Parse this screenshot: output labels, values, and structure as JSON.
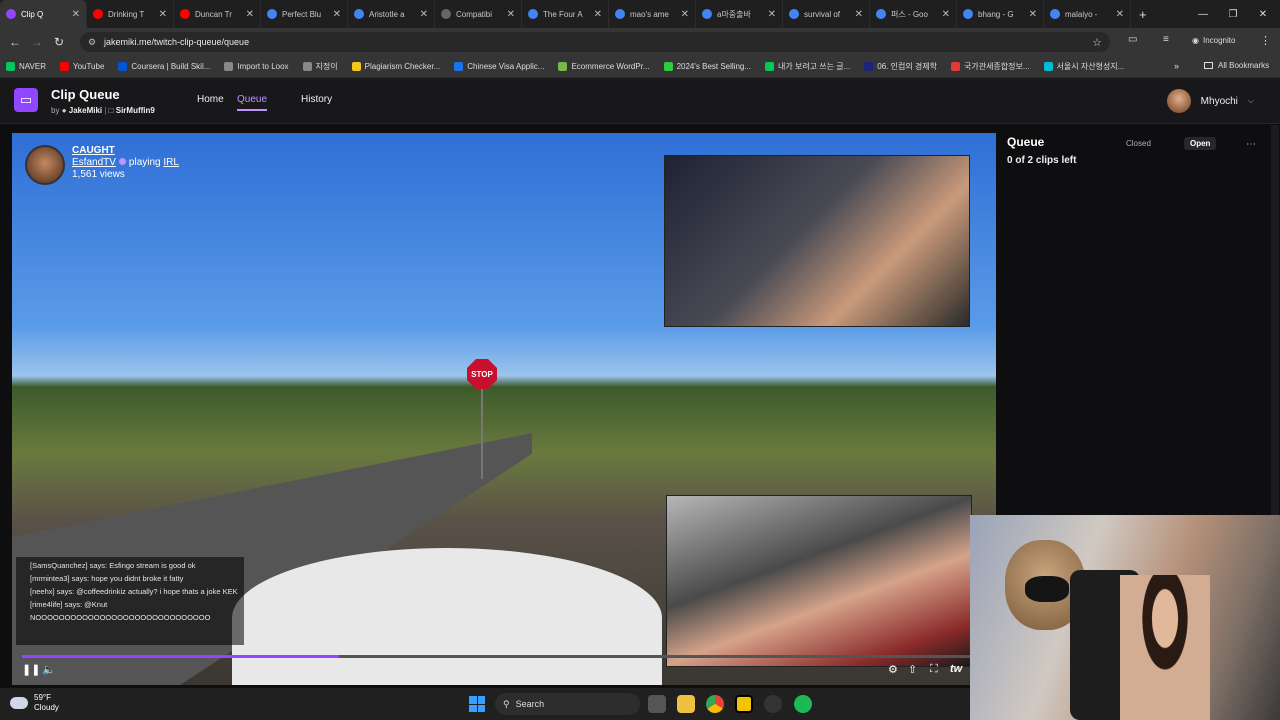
{
  "browser": {
    "tabs": [
      {
        "label": "Clip Q",
        "color": "#9147ff",
        "active": true
      },
      {
        "label": "Drinking T",
        "color": "#ff0000"
      },
      {
        "label": "Duncan Tr",
        "color": "#ff0000"
      },
      {
        "label": "Perfect Blu",
        "color": "#4285f4"
      },
      {
        "label": "Aristotle a",
        "color": "#4285f4"
      },
      {
        "label": "Compatibi",
        "color": "#666666"
      },
      {
        "label": "The Four A",
        "color": "#4285f4"
      },
      {
        "label": "mao's ame",
        "color": "#4285f4"
      },
      {
        "label": "a마중출바",
        "color": "#4285f4"
      },
      {
        "label": "survival of",
        "color": "#4285f4"
      },
      {
        "label": "퍼스 - Goo",
        "color": "#4285f4"
      },
      {
        "label": "bhang - G",
        "color": "#4285f4"
      },
      {
        "label": "malaiyo - ",
        "color": "#4285f4"
      }
    ],
    "url": "jakemiki.me/twitch-clip-queue/queue",
    "incognito_label": "Incognito",
    "all_bookmarks_label": "All Bookmarks",
    "bookmarks": [
      {
        "label": "NAVER",
        "color": "#03c75a"
      },
      {
        "label": "YouTube",
        "color": "#ff0000"
      },
      {
        "label": "Coursera | Build Skil...",
        "color": "#0056d2"
      },
      {
        "label": "Import to Loox",
        "color": "#888888"
      },
      {
        "label": "지정이",
        "color": "#888888"
      },
      {
        "label": "Plagiarism Checker...",
        "color": "#f5c518"
      },
      {
        "label": "Chinese Visa Applic...",
        "color": "#1a73e8"
      },
      {
        "label": "Ecommerce WordPr...",
        "color": "#7ab648"
      },
      {
        "label": "2024's Best Selling...",
        "color": "#2ecc40"
      },
      {
        "label": "내가 보려고 쓰는 글...",
        "color": "#03c75a"
      },
      {
        "label": "06. 인컴의 경제학",
        "color": "#1a237e"
      },
      {
        "label": "국가관세종합정보...",
        "color": "#e53935"
      },
      {
        "label": "서울시 자산형성지...",
        "color": "#00bcd4"
      }
    ]
  },
  "app": {
    "title": "Clip Queue",
    "by_label": "by",
    "author1": "JakeMiki",
    "author2": "SirMuffin9",
    "nav": [
      "Home",
      "Queue",
      "History"
    ],
    "active_nav": "Queue",
    "username": "Mhyochi"
  },
  "clip": {
    "title": "CAUGHT",
    "streamer": "EsfandTV",
    "playing_label": "playing",
    "category": "IRL",
    "views": "1,561 views",
    "stop_sign": "STOP",
    "progress": 0.33
  },
  "chat": [
    "[SamsQuanchez] says: Esfingo stream is good ok",
    "[mrmintea3] says: hope you didnt broke it fatty",
    "[neehx] says: @coffeedrinkiz actually? i hope thats a joke KEK",
    "[rime4life] says: @Knut",
    "NOOOOOOOOOOOOOOOOOOOOOOOOOOOOOO"
  ],
  "queue": {
    "title": "Queue",
    "count_text": "0 of 2 clips left",
    "closed_label": "Closed",
    "open_label": "Open",
    "more_label": "⋯"
  },
  "taskbar": {
    "temperature": "59°F",
    "condition": "Cloudy",
    "search_label": "Search"
  }
}
